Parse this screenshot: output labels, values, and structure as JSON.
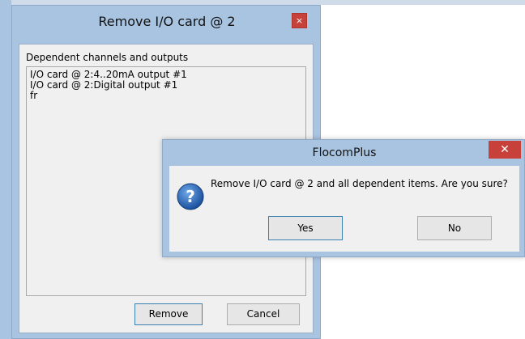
{
  "main_dialog": {
    "title": "Remove I/O card @ 2",
    "close_glyph": "×",
    "group_label": "Dependent channels and outputs",
    "list_items": [
      "I/O card @ 2:4..20mA output #1",
      "I/O card @ 2:Digital output #1",
      "fr"
    ],
    "remove_label": "Remove",
    "cancel_label": "Cancel"
  },
  "message_box": {
    "title": "FlocomPlus",
    "close_glyph": "✕",
    "icon": "question-icon",
    "text": "Remove I/O card @ 2 and all dependent items. Are you sure?",
    "yes_label": "Yes",
    "no_label": "No"
  },
  "colors": {
    "window_frame": "#a9c4e1",
    "close_button": "#c7413a",
    "client_bg": "#f0f0f0",
    "question_icon": "#1f5fb3"
  }
}
